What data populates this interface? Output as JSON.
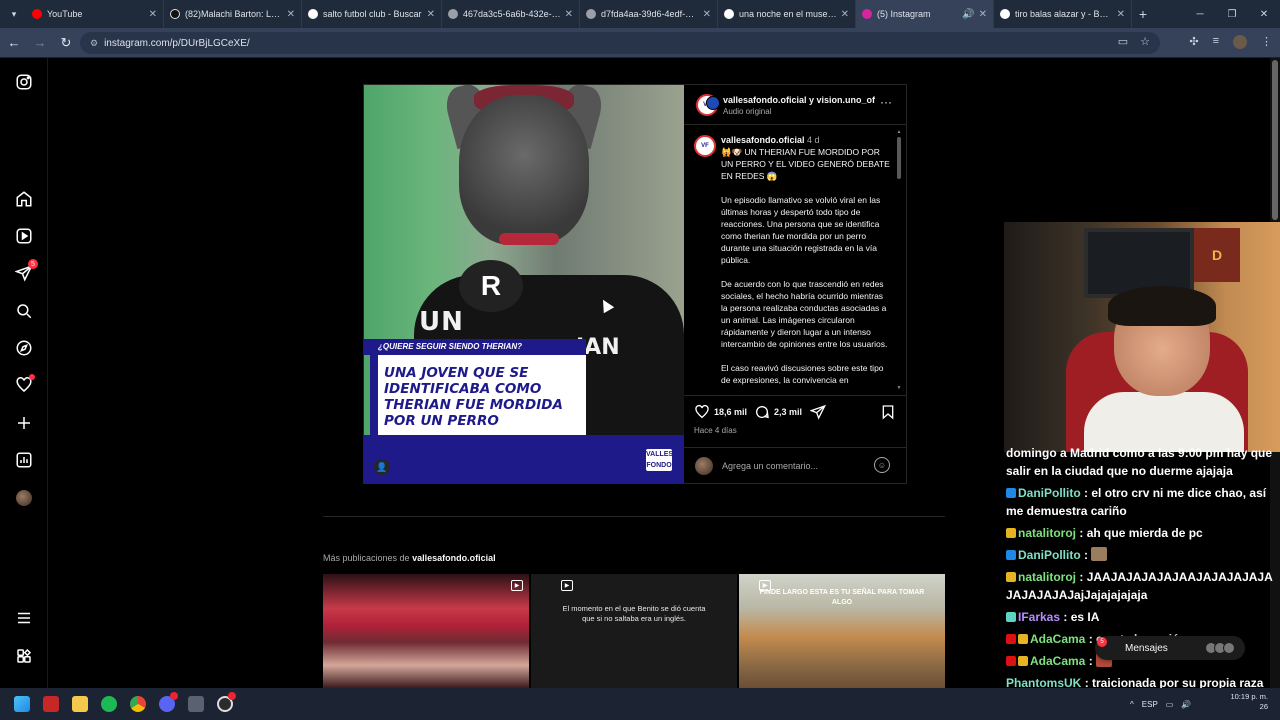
{
  "browser": {
    "tabs": [
      {
        "title": "YouTube",
        "favicon_color": "#ff0000",
        "active": false
      },
      {
        "title": "(82)Malachi Barton: Latest",
        "favicon_color": "#111111",
        "active": false
      },
      {
        "title": "salto futbol club - Buscar",
        "favicon_color": "#4285f4",
        "active": false
      },
      {
        "title": "467da3c5-6a6b-432e-b7",
        "favicon_color": "#9aa0a6",
        "active": false
      },
      {
        "title": "d7fda4aa-39d6-4edf-b97",
        "favicon_color": "#9aa0a6",
        "active": false
      },
      {
        "title": "una noche en el museo e",
        "favicon_color": "#4285f4",
        "active": false
      },
      {
        "title": "(5) Instagram",
        "favicon_color": "#d6249f",
        "active": true
      },
      {
        "title": "tiro balas alazar y - Busca",
        "favicon_color": "#4285f4",
        "active": false
      }
    ],
    "url": "instagram.com/p/DUrBjLGCeXE/"
  },
  "ig_nav": {
    "notifications_badge": "5"
  },
  "post": {
    "header_name": "vallesafondo.oficial y vision.uno_of",
    "header_sub": "Audio original",
    "caption_user": "vallesafondo.oficial",
    "caption_time": "4 d",
    "caption_text": "🙀🐶 UN THERIAN FUE MORDIDO POR UN PERRO Y EL VIDEO GENERÓ DEBATE EN REDES 😱\n\nUn episodio llamativo se volvió viral en las últimas horas y despertó todo tipo de reacciones. Una persona que se identifica como therian fue mordida por un perro durante una situación registrada en la vía pública.\n\nDe acuerdo con lo que trascendió en redes sociales, el hecho habría ocurrido mientras la persona realizaba conductas asociadas a un animal. Las imágenes circularon rápidamente y dieron lugar a un intenso intercambio de opiniones entre los usuarios.\n\nEl caso reavivó discusiones sobre este tipo de expresiones, la convivencia en",
    "likes": "18,6 mil",
    "comments": "2,3 mil",
    "posted": "Hace 4 días",
    "comment_placeholder": "Agrega un comentario...",
    "media_overlay_tag": "¿QUIERE SEGUIR SIENDO THERIAN?",
    "media_overlay_headline": "UNA JOVEN QUE SE IDENTIFICABA COMO THERIAN FUE MORDIDA POR UN PERRO",
    "shirt_text_1": "UN",
    "shirt_text_2": "IAN"
  },
  "more_posts": {
    "label_prefix": "Más publicaciones de",
    "account": "vallesafondo.oficial",
    "items": [
      {
        "caption": ""
      },
      {
        "caption": "El momento en el que Benito se dió cuenta que si no saltaba era un inglés."
      },
      {
        "caption": "FINDE LARGO ESTA ES TU SEÑAL PARA TOMAR ALGO"
      }
    ]
  },
  "chat": {
    "messages": [
      {
        "user": "",
        "user_color": "#ffffff",
        "text": "domingo a Madrid como a las 9:00 pm hay que salir en la ciudad que no duerme ajajaja"
      },
      {
        "user": "DaniPollito",
        "user_color": "#7fe0c5",
        "text": ": el otro crv ni me dice chao, así me demuestra cariño"
      },
      {
        "user": "natalitoroj",
        "user_color": "#7fe07f",
        "text": ": ah que mierda de pc"
      },
      {
        "user": "DaniPollito",
        "user_color": "#7fe0c5",
        "text": ":"
      },
      {
        "user": "natalitoroj",
        "user_color": "#7fe07f",
        "text": ": JAAJAJAJAJAJAAJAJAJAJAJAJAJAJAJAJajJajajajajaja"
      },
      {
        "user": "IFarkas",
        "user_color": "#b78cff",
        "text": ": es IA"
      },
      {
        "user": "AdaCama",
        "user_color": "#7fe07f",
        "text": ": eso te lo envié yo"
      },
      {
        "user": "AdaCama",
        "user_color": "#7fe07f",
        "text": ":"
      },
      {
        "user": "PhantomsUK",
        "user_color": "#7fe0c5",
        "text": ": traicionada por su propia raza"
      }
    ],
    "messages_pill_label": "Mensajes",
    "messages_pill_badge": "5"
  },
  "taskbar": {
    "language": "ESP",
    "time": "10:19 p. m.",
    "date": "26"
  }
}
